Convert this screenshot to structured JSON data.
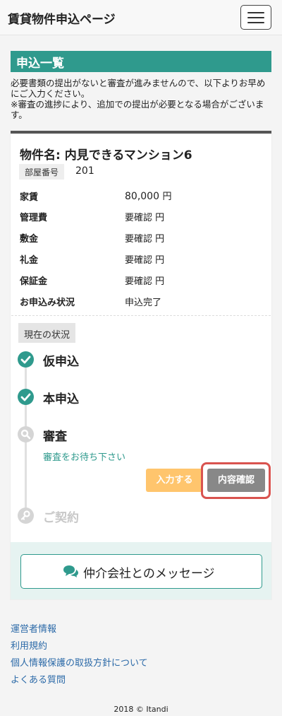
{
  "header": {
    "title": "賃貸物件申込ページ",
    "menu_icon": "hamburger-menu-icon"
  },
  "section": {
    "title": "申込一覧",
    "notice_1": "必要書類の提出がないと審査が進みませんので、以下よりお早めにご入力ください。",
    "notice_2": "※審査の進捗により、追加での提出が必要となる場合がございます。"
  },
  "property": {
    "name": "物件名: 内見できるマンション6",
    "room_label": "部屋番号",
    "room_value": "201",
    "details": [
      {
        "label": "家賃",
        "value": "80,000",
        "unit": "円"
      },
      {
        "label": "管理費",
        "value": "要確認",
        "unit": "円"
      },
      {
        "label": "敷金",
        "value": "要確認",
        "unit": "円"
      },
      {
        "label": "礼金",
        "value": "要確認",
        "unit": "円"
      },
      {
        "label": "保証金",
        "value": "要確認",
        "unit": "円"
      },
      {
        "label": "お申込み状況",
        "value": "申込完了",
        "unit": ""
      }
    ]
  },
  "status": {
    "label": "現在の状況",
    "steps": [
      {
        "label": "仮申込",
        "state": "done",
        "icon": "check-circle-icon"
      },
      {
        "label": "本申込",
        "state": "done",
        "icon": "check-circle-icon"
      },
      {
        "label": "審査",
        "state": "current",
        "icon": "search-icon"
      },
      {
        "label": "ご契約",
        "state": "pending",
        "icon": "key-icon"
      }
    ],
    "waiting_text": "審査をお待ち下さい",
    "input_button": "入力する",
    "confirm_button": "内容確認"
  },
  "message_button": {
    "label": "仲介会社とのメッセージ",
    "icon": "chat-bubbles-icon"
  },
  "footer": {
    "links": [
      "運営者情報",
      "利用規約",
      "個人情報保護の取扱方針について",
      "よくある質問"
    ],
    "copyright": "2018 © Itandi"
  },
  "colors": {
    "accent": "#2f9a8d",
    "warning": "#ffc56d",
    "highlight": "#d9534f",
    "link": "#2c6aa8"
  }
}
